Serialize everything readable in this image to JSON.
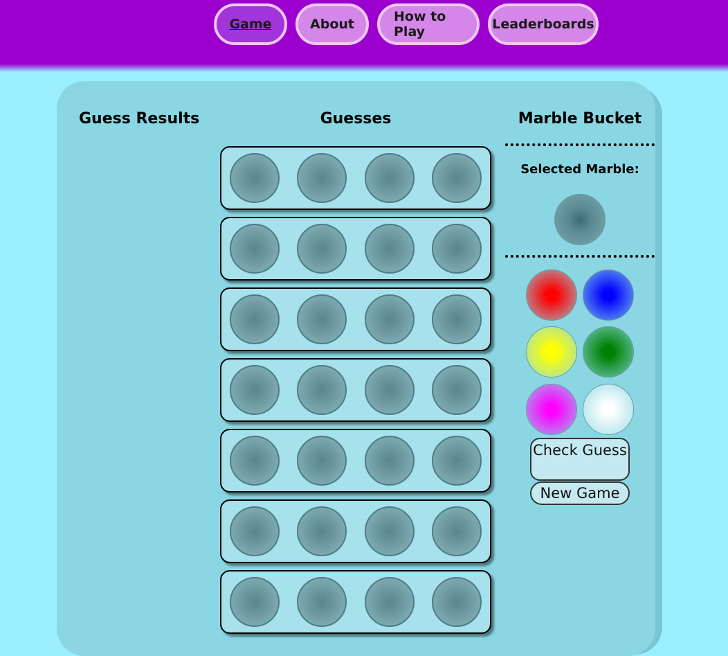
{
  "nav": {
    "items": [
      {
        "label": "Game",
        "active": true
      },
      {
        "label": "About",
        "active": false
      },
      {
        "label": "How to Play",
        "active": false
      },
      {
        "label": "Leaderboards",
        "active": false
      }
    ]
  },
  "board": {
    "results_title": "Guess Results",
    "guesses_title": "Guesses",
    "bucket_title": "Marble Bucket",
    "selected_label": "Selected Marble:",
    "rows_visible": 7,
    "holes_per_row": 4
  },
  "bucket": {
    "marbles": [
      {
        "name": "red",
        "color": "#ff0000"
      },
      {
        "name": "blue",
        "color": "#0000ff"
      },
      {
        "name": "yellow",
        "color": "#ffff00"
      },
      {
        "name": "green",
        "color": "#008000"
      },
      {
        "name": "magenta",
        "color": "#ff00ff"
      },
      {
        "name": "white",
        "color": "#ffffff"
      }
    ]
  },
  "actions": {
    "check_label": "Check Guess",
    "new_game_label": "New Game"
  },
  "colors": {
    "header": "#9b00cf",
    "background": "#9befff",
    "panel": "#8ad7e3",
    "row": "#a6e1ec"
  }
}
